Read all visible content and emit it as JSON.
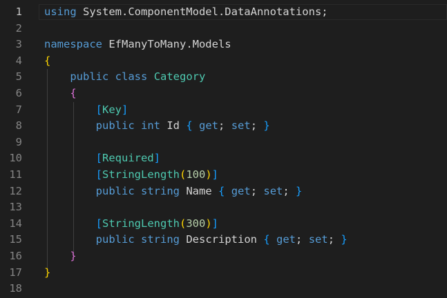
{
  "editor": {
    "active_line": 1,
    "lines": [
      {
        "num": "1",
        "tokens": [
          {
            "t": "using",
            "c": "kw"
          },
          {
            "t": " System.ComponentModel.DataAnnotations;",
            "c": "id"
          }
        ]
      },
      {
        "num": "2",
        "tokens": []
      },
      {
        "num": "3",
        "tokens": [
          {
            "t": "namespace",
            "c": "kw"
          },
          {
            "t": " EfManyToMany.Models",
            "c": "id"
          }
        ]
      },
      {
        "num": "4",
        "tokens": [
          {
            "t": "{",
            "c": "br1"
          }
        ]
      },
      {
        "num": "5",
        "tokens": [
          {
            "t": "    ",
            "c": "id"
          },
          {
            "t": "public",
            "c": "kw"
          },
          {
            "t": " ",
            "c": "id"
          },
          {
            "t": "class",
            "c": "kw"
          },
          {
            "t": " ",
            "c": "id"
          },
          {
            "t": "Category",
            "c": "ty"
          }
        ]
      },
      {
        "num": "6",
        "tokens": [
          {
            "t": "    ",
            "c": "id"
          },
          {
            "t": "{",
            "c": "br2"
          }
        ]
      },
      {
        "num": "7",
        "tokens": [
          {
            "t": "        ",
            "c": "id"
          },
          {
            "t": "[",
            "c": "br3"
          },
          {
            "t": "Key",
            "c": "ty"
          },
          {
            "t": "]",
            "c": "br3"
          }
        ]
      },
      {
        "num": "8",
        "tokens": [
          {
            "t": "        ",
            "c": "id"
          },
          {
            "t": "public",
            "c": "kw"
          },
          {
            "t": " ",
            "c": "id"
          },
          {
            "t": "int",
            "c": "kw"
          },
          {
            "t": " Id ",
            "c": "id"
          },
          {
            "t": "{",
            "c": "br3"
          },
          {
            "t": " ",
            "c": "id"
          },
          {
            "t": "get",
            "c": "kw"
          },
          {
            "t": "; ",
            "c": "id"
          },
          {
            "t": "set",
            "c": "kw"
          },
          {
            "t": "; ",
            "c": "id"
          },
          {
            "t": "}",
            "c": "br3"
          }
        ]
      },
      {
        "num": "9",
        "tokens": []
      },
      {
        "num": "10",
        "tokens": [
          {
            "t": "        ",
            "c": "id"
          },
          {
            "t": "[",
            "c": "br3"
          },
          {
            "t": "Required",
            "c": "ty"
          },
          {
            "t": "]",
            "c": "br3"
          }
        ]
      },
      {
        "num": "11",
        "tokens": [
          {
            "t": "        ",
            "c": "id"
          },
          {
            "t": "[",
            "c": "br3"
          },
          {
            "t": "StringLength",
            "c": "ty"
          },
          {
            "t": "(",
            "c": "br1"
          },
          {
            "t": "100",
            "c": "num"
          },
          {
            "t": ")",
            "c": "br1"
          },
          {
            "t": "]",
            "c": "br3"
          }
        ]
      },
      {
        "num": "12",
        "tokens": [
          {
            "t": "        ",
            "c": "id"
          },
          {
            "t": "public",
            "c": "kw"
          },
          {
            "t": " ",
            "c": "id"
          },
          {
            "t": "string",
            "c": "kw"
          },
          {
            "t": " Name ",
            "c": "id"
          },
          {
            "t": "{",
            "c": "br3"
          },
          {
            "t": " ",
            "c": "id"
          },
          {
            "t": "get",
            "c": "kw"
          },
          {
            "t": "; ",
            "c": "id"
          },
          {
            "t": "set",
            "c": "kw"
          },
          {
            "t": "; ",
            "c": "id"
          },
          {
            "t": "}",
            "c": "br3"
          }
        ]
      },
      {
        "num": "13",
        "tokens": []
      },
      {
        "num": "14",
        "tokens": [
          {
            "t": "        ",
            "c": "id"
          },
          {
            "t": "[",
            "c": "br3"
          },
          {
            "t": "StringLength",
            "c": "ty"
          },
          {
            "t": "(",
            "c": "br1"
          },
          {
            "t": "300",
            "c": "num"
          },
          {
            "t": ")",
            "c": "br1"
          },
          {
            "t": "]",
            "c": "br3"
          }
        ]
      },
      {
        "num": "15",
        "tokens": [
          {
            "t": "        ",
            "c": "id"
          },
          {
            "t": "public",
            "c": "kw"
          },
          {
            "t": " ",
            "c": "id"
          },
          {
            "t": "string",
            "c": "kw"
          },
          {
            "t": " Description ",
            "c": "id"
          },
          {
            "t": "{",
            "c": "br3"
          },
          {
            "t": " ",
            "c": "id"
          },
          {
            "t": "get",
            "c": "kw"
          },
          {
            "t": "; ",
            "c": "id"
          },
          {
            "t": "set",
            "c": "kw"
          },
          {
            "t": "; ",
            "c": "id"
          },
          {
            "t": "}",
            "c": "br3"
          }
        ]
      },
      {
        "num": "16",
        "tokens": [
          {
            "t": "    ",
            "c": "id"
          },
          {
            "t": "}",
            "c": "br2"
          }
        ]
      },
      {
        "num": "17",
        "tokens": [
          {
            "t": "}",
            "c": "br1"
          }
        ]
      },
      {
        "num": "18",
        "tokens": []
      }
    ]
  },
  "colors": {
    "background": "#1e1e1e",
    "keyword": "#569cd6",
    "type": "#4ec9b0",
    "number": "#b5cea8",
    "bracket_level1": "#ffd700",
    "bracket_level2": "#da70d6",
    "bracket_level3": "#179fff"
  }
}
